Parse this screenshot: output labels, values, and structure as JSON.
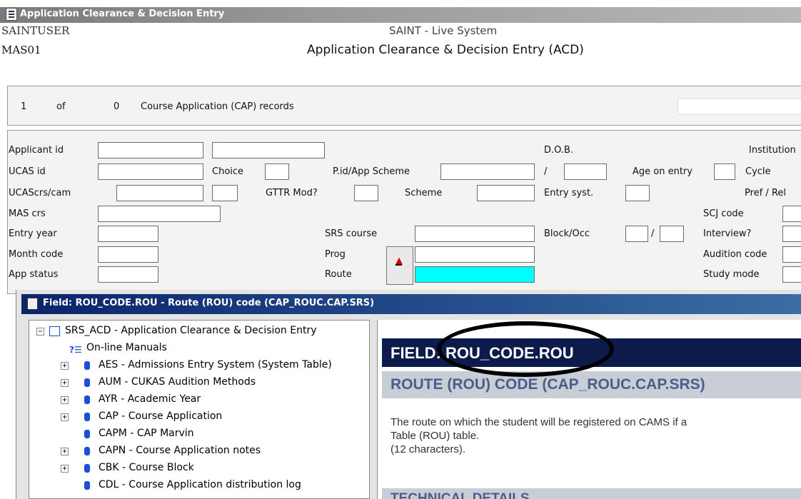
{
  "window": {
    "title": "Application Clearance & Decision Entry"
  },
  "header": {
    "user": "SAINTUSER",
    "system": "SAINT - Live System",
    "code": "MAS01",
    "screen": "Application Clearance & Decision Entry (ACD)"
  },
  "records": {
    "current": "1",
    "of": "of",
    "total": "0",
    "label": "Course Application (CAP) records"
  },
  "form": {
    "applicant_id": "Applicant id",
    "ucas_id": "UCAS id",
    "choice": "Choice",
    "pid_app_scheme": "P.id/App Scheme",
    "ucascrs_cam": "UCAScrs/cam",
    "gttr_mod": "GTTR Mod?",
    "scheme": "Scheme",
    "mas_crs": "MAS crs",
    "entry_year": "Entry year",
    "srs_course": "SRS course",
    "month_code": "Month code",
    "prog": "Prog",
    "app_status": "App status",
    "route": "Route",
    "dob": "D.O.B.",
    "slash": "/",
    "age_on_entry": "Age on entry",
    "entry_syst": "Entry syst.",
    "block_occ": "Block/Occ",
    "block_slash": "/",
    "institution": "Institution",
    "cycle": "Cycle",
    "pref_rel": "Pref / Rel",
    "scj_code": "SCJ code",
    "interview": "Interview?",
    "audition_code": "Audition code",
    "study_mode": "Study mode"
  },
  "field_window": {
    "title": "Field: ROU_CODE.ROU - Route (ROU) code (CAP_ROUC.CAP.SRS)"
  },
  "tree": {
    "root": "SRS_ACD - Application Clearance & Decision Entry",
    "items": [
      {
        "label": "On-line Manuals"
      },
      {
        "label": "AES - Admissions Entry System (System Table)"
      },
      {
        "label": "AUM - CUKAS Audition Methods"
      },
      {
        "label": "AYR - Academic Year"
      },
      {
        "label": "CAP - Course Application"
      },
      {
        "label": "CAPM - CAP Marvin"
      },
      {
        "label": "CAPN - Course Application notes"
      },
      {
        "label": "CBK - Course Block"
      },
      {
        "label": "CDL - Course Application distribution log"
      }
    ]
  },
  "doc": {
    "h1": "FIELD: ROU_CODE.ROU",
    "h2": "ROUTE (ROU) CODE (CAP_ROUC.CAP.SRS)",
    "p1": "The route on which the student will be registered on CAMS if a",
    "p2": "Table (ROU) table.",
    "p3": "(12 characters).",
    "h3": "TECHNICAL DETAILS"
  }
}
